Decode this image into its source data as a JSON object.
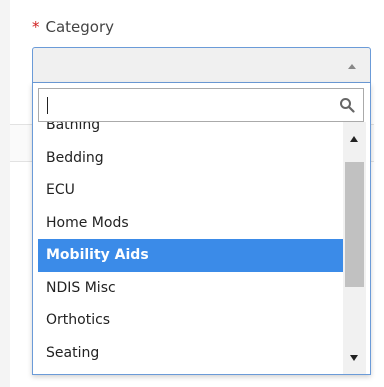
{
  "form": {
    "required_mark": "*",
    "category_label": "Category",
    "selected_value": ""
  },
  "dropdown": {
    "search_value": "",
    "search_icon": "search-icon",
    "options": [
      {
        "label": "Bathing"
      },
      {
        "label": "Bedding"
      },
      {
        "label": "ECU"
      },
      {
        "label": "Home Mods"
      },
      {
        "label": "Mobility Aids",
        "highlighted": true
      },
      {
        "label": "NDIS Misc"
      },
      {
        "label": "Orthotics"
      },
      {
        "label": "Seating"
      }
    ],
    "scrollbar": {
      "thumb_fraction": 0.53,
      "position_fraction": 0.05
    }
  },
  "colors": {
    "highlight": "#3b8be8",
    "focus_border": "#6b9bd8",
    "required": "#d02020"
  }
}
